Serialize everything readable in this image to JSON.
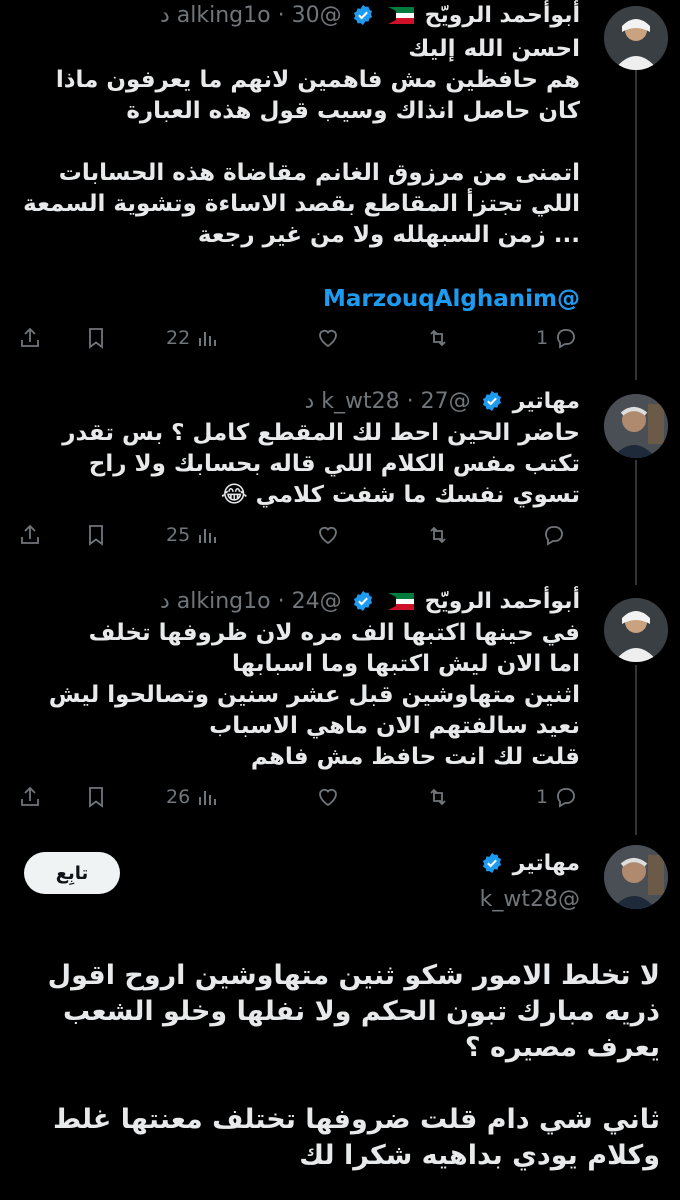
{
  "tweets": [
    {
      "name": "أبوأحمد الرويّح",
      "handle": "@alking1o",
      "time": "30 د",
      "sep": "·",
      "text": "احسن الله إليك\nهم حافظين مش فاهمين لانهم ما يعرفون ماذا كان حاصل انذاك وسيب قول هذه العبارة\n\nاتمنى من مرزوق الغانم مقاضاة هذه الحسابات اللي تجتزأ المقاطع بقصد الاساءة وتشوية السمعة ... زمن السبهلله ولا من غير رجعة",
      "mention": "@MarzouqAlghanim",
      "reply_count": "1",
      "views": "22"
    },
    {
      "name": "مهاتير",
      "handle": "@k_wt28",
      "time": "27 د",
      "sep": "·",
      "text": "حاضر الحين احط لك المقطع كامل ؟ بس تقدر تكتب مفس الكلام اللي قاله بحسابك ولا راح تسوي نفسك ما شفت كلامي 😂",
      "reply_count": "",
      "views": "25"
    },
    {
      "name": "أبوأحمد الرويّح",
      "handle": "@alking1o",
      "time": "24 د",
      "sep": "·",
      "text": "في حينها اكتبها الف مره لان ظروفها تخلف\nاما الان ليش اكتبها وما اسبابها\nاثنين متهاوشين قبل عشر سنين وتصالحوا ليش نعيد سالفتهم الان ماهي الاسباب\nقلت لك انت حافظ مش فاهم",
      "reply_count": "1",
      "views": "26"
    }
  ],
  "main_tweet": {
    "name": "مهاتير",
    "handle": "@k_wt28",
    "follow_label": "تابِع",
    "text": "لا تخلط الامور شكو ثنين متهاوشين اروح اقول ذريه مبارك تبون الحكم ولا نفلها وخلو الشعب يعرف مصيره ؟\n\nثاني شي دام قلت ضروفها تختلف معنتها غلط وكلام يودي بداهيه شكرا لك"
  },
  "colors": {
    "background": "#000000",
    "text": "#e7e9ea",
    "muted": "#71767b",
    "link": "#1d9bf0",
    "verified": "#1d9bf0"
  },
  "icons": [
    "share-icon",
    "bookmark-icon",
    "views-icon",
    "like-icon",
    "retweet-icon",
    "reply-icon",
    "verified-icon",
    "kuwait-flag-icon"
  ]
}
